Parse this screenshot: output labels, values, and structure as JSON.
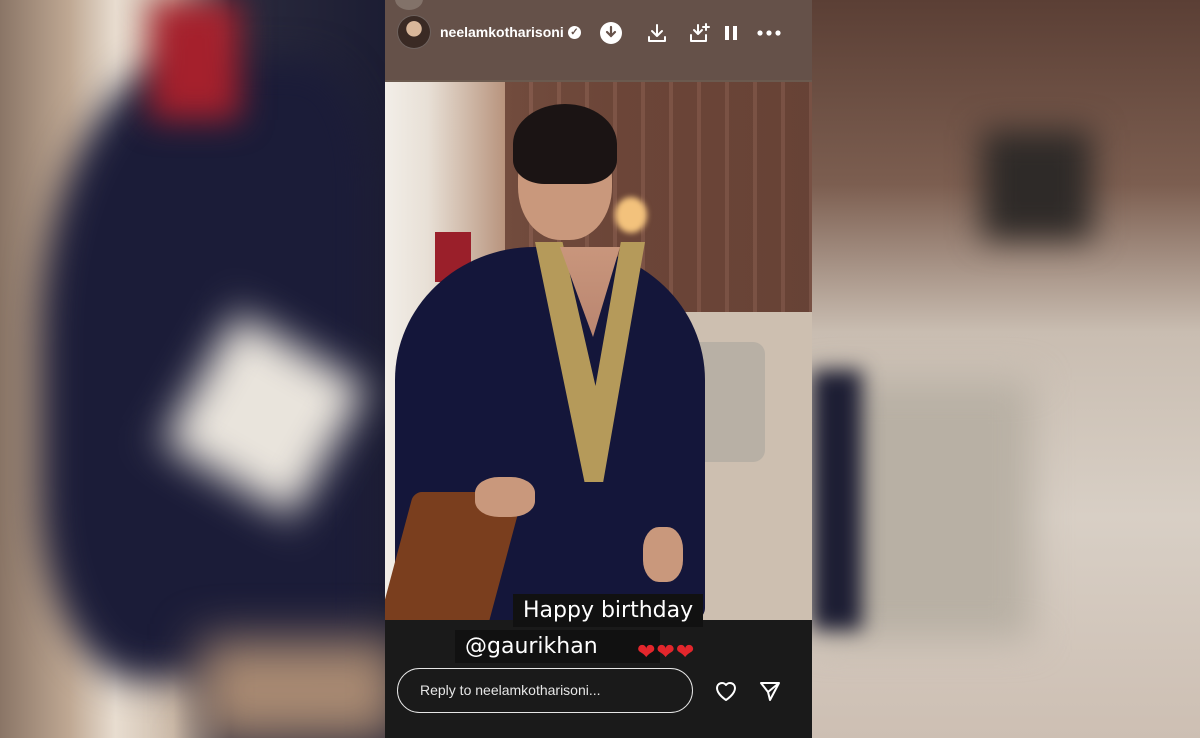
{
  "story": {
    "username": "neelamkotharisoni",
    "verified_badge": "✓",
    "header_icons": [
      "download-circle-icon",
      "download-icon",
      "save-icon",
      "pause-icon",
      "more-options-icon"
    ],
    "caption_line1": "Happy birthday",
    "caption_line2": "@gaurikhan",
    "hearts": "❤❤❤"
  },
  "reply": {
    "placeholder": "Reply to neelamkotharisoni...",
    "like_icon": "heart-icon",
    "send_icon": "send-icon"
  },
  "colors": {
    "header_bg": "#655149",
    "footer_bg": "#1a1a1a",
    "heart_red": "#e3262c"
  }
}
